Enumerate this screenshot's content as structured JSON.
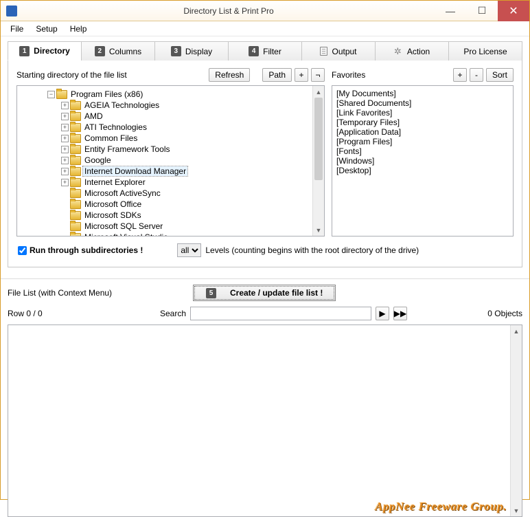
{
  "window": {
    "title": "Directory List & Print Pro"
  },
  "menu": {
    "file": "File",
    "setup": "Setup",
    "help": "Help"
  },
  "tabs": {
    "directory": "Directory",
    "columns": "Columns",
    "display": "Display",
    "filter": "Filter",
    "output": "Output",
    "action": "Action",
    "pro": "Pro License"
  },
  "left": {
    "label": "Starting directory of the file list",
    "refresh": "Refresh",
    "path": "Path",
    "plus": "+",
    "neg": "¬"
  },
  "right": {
    "label": "Favorites",
    "plus": "+",
    "minus": "-",
    "sort": "Sort"
  },
  "tree": {
    "root": "Program Files (x86)",
    "items": [
      "AGEIA Technologies",
      "AMD",
      "ATI Technologies",
      "Common Files",
      "Entity Framework Tools",
      "Google",
      "Internet Download Manager",
      "Internet Explorer",
      "Microsoft ActiveSync",
      "Microsoft Office",
      "Microsoft SDKs",
      "Microsoft SQL Server",
      "Microsoft Visual Studio"
    ],
    "selected_index": 6
  },
  "favorites": [
    "[My Documents]",
    "[Shared Documents]",
    "[Link Favorites]",
    "[Temporary Files]",
    "[Application Data]",
    "[Program Files]",
    "[Fonts]",
    "[Windows]",
    "[Desktop]"
  ],
  "run": {
    "checkbox": "Run through subdirectories !",
    "checked": true,
    "level_value": "all",
    "levels": "Levels  (counting begins with the root directory of the drive)"
  },
  "filelist": {
    "label": "File List (with Context Menu)",
    "bigbutton": "Create / update file list !",
    "row": "Row 0 / 0",
    "search": "Search",
    "objects": "0 Objects",
    "play": "▶",
    "ff": "▶▶"
  },
  "watermark": "AppNee Freeware Group."
}
